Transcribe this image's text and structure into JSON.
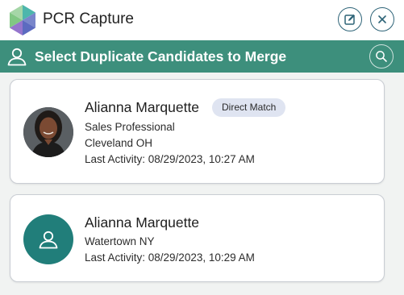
{
  "app": {
    "title": "PCR Capture"
  },
  "header": {
    "title": "Select Duplicate Candidates to Merge",
    "icons": {
      "edit": "edit-icon",
      "close": "close-icon",
      "search": "search-icon",
      "user": "user-icon"
    }
  },
  "candidates": [
    {
      "name": "Alianna Marquette",
      "badge": "Direct Match",
      "title": "Sales Professional",
      "location": "Cleveland OH",
      "last_activity": "Last Activity: 08/29/2023, 10:27 AM"
    },
    {
      "name": "Alianna Marquette",
      "location": "Watertown NY",
      "last_activity": "Last Activity: 08/29/2023, 10:29 AM"
    }
  ],
  "colors": {
    "banner": "#3d8f7c",
    "avatar": "#217e7a",
    "badge": "#dfe4f1",
    "icon_outline": "#2d6377"
  }
}
